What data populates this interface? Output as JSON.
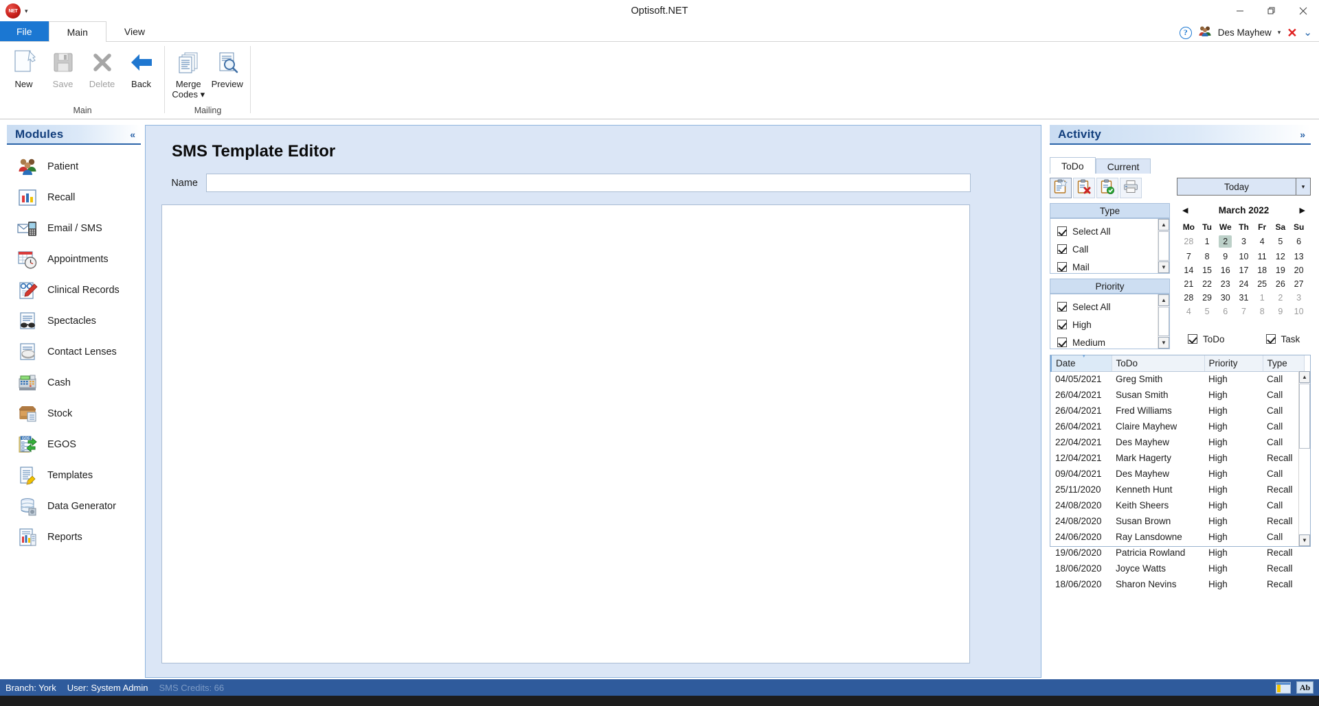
{
  "window": {
    "title": "Optisoft.NET",
    "quick_access_icon": "net-logo-icon",
    "quick_access_caret": "▾",
    "minimize": "minimize-icon",
    "maximize": "restore-icon",
    "close": "close-icon"
  },
  "ribbon": {
    "tabs": [
      {
        "label": "File",
        "active": false,
        "kind": "file"
      },
      {
        "label": "Main",
        "active": true,
        "kind": "normal"
      },
      {
        "label": "View",
        "active": false,
        "kind": "normal"
      }
    ],
    "right": {
      "help_label": "?",
      "user_label": "Des Mayhew",
      "user_caret": "▾",
      "close_x": "✕",
      "collapse_caret": "⌄"
    },
    "groups": [
      {
        "label": "Main",
        "buttons": [
          {
            "label": "New",
            "icon": "new-document-icon",
            "disabled": false
          },
          {
            "label": "Save",
            "icon": "save-floppy-icon",
            "disabled": true
          },
          {
            "label": "Delete",
            "icon": "delete-x-icon",
            "disabled": true
          },
          {
            "label": "Back",
            "icon": "back-arrow-icon",
            "disabled": false
          }
        ]
      },
      {
        "label": "Mailing",
        "buttons": [
          {
            "label": "Merge",
            "label2": "Codes ▾",
            "icon": "merge-codes-icon",
            "disabled": false
          },
          {
            "label": "Preview",
            "label2": "",
            "icon": "preview-magnifier-icon",
            "disabled": false
          }
        ]
      }
    ]
  },
  "sidebar": {
    "title": "Modules",
    "collapse_label": "«",
    "items": [
      {
        "label": "Patient",
        "icon": "patients-group-icon"
      },
      {
        "label": "Recall",
        "icon": "bar-chart-icon"
      },
      {
        "label": "Email / SMS",
        "icon": "email-phone-icon"
      },
      {
        "label": "Appointments",
        "icon": "calendar-clock-icon"
      },
      {
        "label": "Clinical Records",
        "icon": "clinical-pencil-icon"
      },
      {
        "label": "Spectacles",
        "icon": "spectacles-icon"
      },
      {
        "label": "Contact Lenses",
        "icon": "contact-lens-icon"
      },
      {
        "label": "Cash",
        "icon": "cash-register-icon"
      },
      {
        "label": "Stock",
        "icon": "stock-box-icon"
      },
      {
        "label": "EGOS",
        "icon": "egos-forms-icon"
      },
      {
        "label": "Templates",
        "icon": "template-pencil-icon"
      },
      {
        "label": "Data Generator",
        "icon": "data-generator-icon"
      },
      {
        "label": "Reports",
        "icon": "reports-icon"
      }
    ]
  },
  "editor": {
    "title": "SMS Template Editor",
    "name_label": "Name",
    "name_value": "",
    "name_placeholder": "",
    "body_value": "",
    "body_placeholder": ""
  },
  "activity": {
    "title": "Activity",
    "expand_label": "»",
    "tabs": [
      {
        "label": "ToDo",
        "active": true
      },
      {
        "label": "Current",
        "active": false
      }
    ],
    "toolbar": [
      {
        "icon": "new-todo-icon",
        "selected": true
      },
      {
        "icon": "delete-todo-icon",
        "selected": false
      },
      {
        "icon": "complete-todo-icon",
        "selected": false
      },
      {
        "icon": "print-icon",
        "selected": false
      }
    ],
    "type_filter": {
      "header": "Type",
      "options": [
        {
          "label": "Select All",
          "checked": true
        },
        {
          "label": "Call",
          "checked": true
        },
        {
          "label": "Mail",
          "checked": true
        }
      ],
      "scroll_up": "▲",
      "scroll_down": "▼"
    },
    "priority_filter": {
      "header": "Priority",
      "options": [
        {
          "label": "Select All",
          "checked": true
        },
        {
          "label": "High",
          "checked": true
        },
        {
          "label": "Medium",
          "checked": true
        }
      ],
      "scroll_up": "▲",
      "scroll_down": "▼"
    },
    "date_selector": {
      "label": "Today",
      "caret": "▾"
    },
    "calendar": {
      "month": "March 2022",
      "prev": "◀",
      "next": "▶",
      "weekdays": [
        "Mo",
        "Tu",
        "We",
        "Th",
        "Fr",
        "Sa",
        "Su"
      ],
      "weeks": [
        [
          {
            "d": "28",
            "o": true
          },
          {
            "d": "1"
          },
          {
            "d": "2",
            "today": true
          },
          {
            "d": "3"
          },
          {
            "d": "4"
          },
          {
            "d": "5"
          },
          {
            "d": "6"
          }
        ],
        [
          {
            "d": "7"
          },
          {
            "d": "8"
          },
          {
            "d": "9"
          },
          {
            "d": "10"
          },
          {
            "d": "11"
          },
          {
            "d": "12"
          },
          {
            "d": "13"
          }
        ],
        [
          {
            "d": "14"
          },
          {
            "d": "15"
          },
          {
            "d": "16"
          },
          {
            "d": "17"
          },
          {
            "d": "18"
          },
          {
            "d": "19"
          },
          {
            "d": "20"
          }
        ],
        [
          {
            "d": "21"
          },
          {
            "d": "22"
          },
          {
            "d": "23"
          },
          {
            "d": "24"
          },
          {
            "d": "25"
          },
          {
            "d": "26"
          },
          {
            "d": "27"
          }
        ],
        [
          {
            "d": "28"
          },
          {
            "d": "29"
          },
          {
            "d": "30"
          },
          {
            "d": "31"
          },
          {
            "d": "1",
            "o": true
          },
          {
            "d": "2",
            "o": true
          },
          {
            "d": "3",
            "o": true
          }
        ],
        [
          {
            "d": "4",
            "o": true
          },
          {
            "d": "5",
            "o": true
          },
          {
            "d": "6",
            "o": true
          },
          {
            "d": "7",
            "o": true
          },
          {
            "d": "8",
            "o": true
          },
          {
            "d": "9",
            "o": true
          },
          {
            "d": "10",
            "o": true
          }
        ]
      ]
    },
    "toggles": [
      {
        "label": "ToDo",
        "checked": true
      },
      {
        "label": "Task",
        "checked": true
      }
    ],
    "grid": {
      "columns": [
        "Date",
        "ToDo",
        "Priority",
        "Type",
        ""
      ],
      "sorted_column": "Date",
      "rows": [
        [
          "04/05/2021",
          "Greg Smith",
          "High",
          "Call"
        ],
        [
          "26/04/2021",
          "Susan Smith",
          "High",
          "Call"
        ],
        [
          "26/04/2021",
          "Fred Williams",
          "High",
          "Call"
        ],
        [
          "26/04/2021",
          "Claire Mayhew",
          "High",
          "Call"
        ],
        [
          "22/04/2021",
          "Des Mayhew",
          "High",
          "Call"
        ],
        [
          "12/04/2021",
          "Mark Hagerty",
          "High",
          "Recall"
        ],
        [
          "09/04/2021",
          "Des Mayhew",
          "High",
          "Call"
        ],
        [
          "25/11/2020",
          "Kenneth Hunt",
          "High",
          "Recall"
        ],
        [
          "24/08/2020",
          "Keith Sheers",
          "High",
          "Call"
        ],
        [
          "24/08/2020",
          "Susan Brown",
          "High",
          "Recall"
        ],
        [
          "24/06/2020",
          "Ray Lansdowne",
          "High",
          "Call"
        ],
        [
          "19/06/2020",
          "Patricia Rowland",
          "High",
          "Recall"
        ],
        [
          "18/06/2020",
          "Joyce Watts",
          "High",
          "Recall"
        ],
        [
          "18/06/2020",
          "Sharon Nevins",
          "High",
          "Recall"
        ]
      ],
      "scroll_up": "▲",
      "scroll_down": "▼"
    }
  },
  "statusbar": {
    "branch": "Branch: York",
    "user": "User: System Admin",
    "sms_credits": "SMS Credits: 66",
    "icon_window": "window-icon",
    "icon_ab": "Ab"
  },
  "colors": {
    "accent": "#1b77d2",
    "panel_bg": "#dbe6f6",
    "statusbar": "#2f5b9c",
    "heading": "#123e7c"
  }
}
